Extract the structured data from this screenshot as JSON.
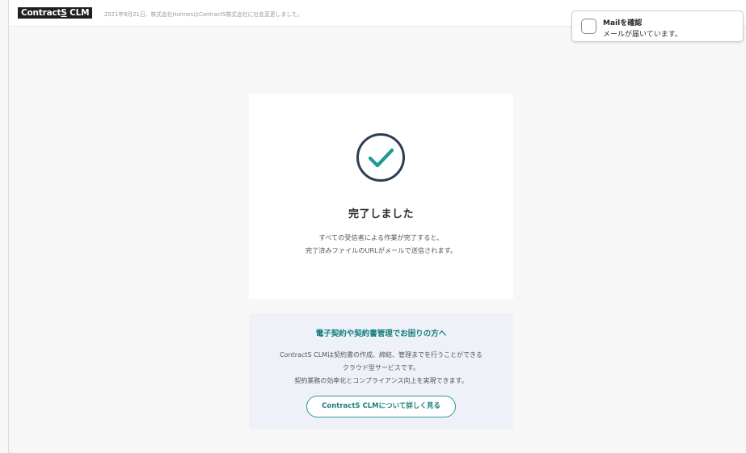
{
  "header": {
    "logo_main": "Contract",
    "logo_s": "S",
    "logo_suffix": " CLM",
    "notice": "2021年8月21日、株式会社HolmesはContractS株式会社に社名変更しました。"
  },
  "mail_toast": {
    "title": "Mailを確認",
    "message": "メールが届いています。"
  },
  "completion": {
    "title": "完了しました",
    "description_line1": "すべての受信者による作業が完了すると、",
    "description_line2": "完了済みファイルのURLがメールで送信されます。",
    "icon": "check-circle-icon",
    "accent_color": "#1f9b93",
    "ring_color": "#2c3e50"
  },
  "promo": {
    "title": "電子契約や契約書管理でお困りの方へ",
    "line1": "ContractS CLMは契約書の作成、締結、管理までを行うことができる",
    "line2": "クラウド型サービスです。",
    "line3": "契約業務の効率化とコンプライアンス向上を実現できます。",
    "button_label": "ContractS CLMについて詳しく見る",
    "accent_color": "#177e7e"
  }
}
